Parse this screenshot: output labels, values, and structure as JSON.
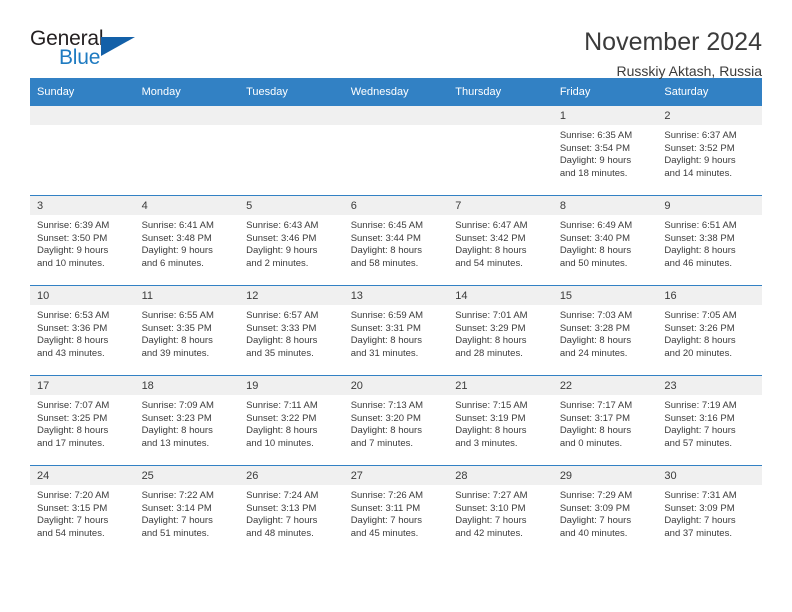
{
  "brand": {
    "general": "General",
    "blue": "Blue",
    "triangle_color": "#1360a8",
    "blue_color": "#1f7bc1"
  },
  "header": {
    "title": "November 2024",
    "subtitle": "Russkiy Aktash, Russia"
  },
  "theme": {
    "header_bg": "#3281c4",
    "daynum_band_bg": "#f0f0f0",
    "text": "#3b3b3b"
  },
  "weekday_headers": [
    "Sunday",
    "Monday",
    "Tuesday",
    "Wednesday",
    "Thursday",
    "Friday",
    "Saturday"
  ],
  "weeks": [
    [
      {
        "day": "",
        "sunrise": "",
        "sunset": "",
        "daylight_line1": "",
        "daylight_line2": ""
      },
      {
        "day": "",
        "sunrise": "",
        "sunset": "",
        "daylight_line1": "",
        "daylight_line2": ""
      },
      {
        "day": "",
        "sunrise": "",
        "sunset": "",
        "daylight_line1": "",
        "daylight_line2": ""
      },
      {
        "day": "",
        "sunrise": "",
        "sunset": "",
        "daylight_line1": "",
        "daylight_line2": ""
      },
      {
        "day": "",
        "sunrise": "",
        "sunset": "",
        "daylight_line1": "",
        "daylight_line2": ""
      },
      {
        "day": "1",
        "sunrise": "Sunrise: 6:35 AM",
        "sunset": "Sunset: 3:54 PM",
        "daylight_line1": "Daylight: 9 hours",
        "daylight_line2": "and 18 minutes."
      },
      {
        "day": "2",
        "sunrise": "Sunrise: 6:37 AM",
        "sunset": "Sunset: 3:52 PM",
        "daylight_line1": "Daylight: 9 hours",
        "daylight_line2": "and 14 minutes."
      }
    ],
    [
      {
        "day": "3",
        "sunrise": "Sunrise: 6:39 AM",
        "sunset": "Sunset: 3:50 PM",
        "daylight_line1": "Daylight: 9 hours",
        "daylight_line2": "and 10 minutes."
      },
      {
        "day": "4",
        "sunrise": "Sunrise: 6:41 AM",
        "sunset": "Sunset: 3:48 PM",
        "daylight_line1": "Daylight: 9 hours",
        "daylight_line2": "and 6 minutes."
      },
      {
        "day": "5",
        "sunrise": "Sunrise: 6:43 AM",
        "sunset": "Sunset: 3:46 PM",
        "daylight_line1": "Daylight: 9 hours",
        "daylight_line2": "and 2 minutes."
      },
      {
        "day": "6",
        "sunrise": "Sunrise: 6:45 AM",
        "sunset": "Sunset: 3:44 PM",
        "daylight_line1": "Daylight: 8 hours",
        "daylight_line2": "and 58 minutes."
      },
      {
        "day": "7",
        "sunrise": "Sunrise: 6:47 AM",
        "sunset": "Sunset: 3:42 PM",
        "daylight_line1": "Daylight: 8 hours",
        "daylight_line2": "and 54 minutes."
      },
      {
        "day": "8",
        "sunrise": "Sunrise: 6:49 AM",
        "sunset": "Sunset: 3:40 PM",
        "daylight_line1": "Daylight: 8 hours",
        "daylight_line2": "and 50 minutes."
      },
      {
        "day": "9",
        "sunrise": "Sunrise: 6:51 AM",
        "sunset": "Sunset: 3:38 PM",
        "daylight_line1": "Daylight: 8 hours",
        "daylight_line2": "and 46 minutes."
      }
    ],
    [
      {
        "day": "10",
        "sunrise": "Sunrise: 6:53 AM",
        "sunset": "Sunset: 3:36 PM",
        "daylight_line1": "Daylight: 8 hours",
        "daylight_line2": "and 43 minutes."
      },
      {
        "day": "11",
        "sunrise": "Sunrise: 6:55 AM",
        "sunset": "Sunset: 3:35 PM",
        "daylight_line1": "Daylight: 8 hours",
        "daylight_line2": "and 39 minutes."
      },
      {
        "day": "12",
        "sunrise": "Sunrise: 6:57 AM",
        "sunset": "Sunset: 3:33 PM",
        "daylight_line1": "Daylight: 8 hours",
        "daylight_line2": "and 35 minutes."
      },
      {
        "day": "13",
        "sunrise": "Sunrise: 6:59 AM",
        "sunset": "Sunset: 3:31 PM",
        "daylight_line1": "Daylight: 8 hours",
        "daylight_line2": "and 31 minutes."
      },
      {
        "day": "14",
        "sunrise": "Sunrise: 7:01 AM",
        "sunset": "Sunset: 3:29 PM",
        "daylight_line1": "Daylight: 8 hours",
        "daylight_line2": "and 28 minutes."
      },
      {
        "day": "15",
        "sunrise": "Sunrise: 7:03 AM",
        "sunset": "Sunset: 3:28 PM",
        "daylight_line1": "Daylight: 8 hours",
        "daylight_line2": "and 24 minutes."
      },
      {
        "day": "16",
        "sunrise": "Sunrise: 7:05 AM",
        "sunset": "Sunset: 3:26 PM",
        "daylight_line1": "Daylight: 8 hours",
        "daylight_line2": "and 20 minutes."
      }
    ],
    [
      {
        "day": "17",
        "sunrise": "Sunrise: 7:07 AM",
        "sunset": "Sunset: 3:25 PM",
        "daylight_line1": "Daylight: 8 hours",
        "daylight_line2": "and 17 minutes."
      },
      {
        "day": "18",
        "sunrise": "Sunrise: 7:09 AM",
        "sunset": "Sunset: 3:23 PM",
        "daylight_line1": "Daylight: 8 hours",
        "daylight_line2": "and 13 minutes."
      },
      {
        "day": "19",
        "sunrise": "Sunrise: 7:11 AM",
        "sunset": "Sunset: 3:22 PM",
        "daylight_line1": "Daylight: 8 hours",
        "daylight_line2": "and 10 minutes."
      },
      {
        "day": "20",
        "sunrise": "Sunrise: 7:13 AM",
        "sunset": "Sunset: 3:20 PM",
        "daylight_line1": "Daylight: 8 hours",
        "daylight_line2": "and 7 minutes."
      },
      {
        "day": "21",
        "sunrise": "Sunrise: 7:15 AM",
        "sunset": "Sunset: 3:19 PM",
        "daylight_line1": "Daylight: 8 hours",
        "daylight_line2": "and 3 minutes."
      },
      {
        "day": "22",
        "sunrise": "Sunrise: 7:17 AM",
        "sunset": "Sunset: 3:17 PM",
        "daylight_line1": "Daylight: 8 hours",
        "daylight_line2": "and 0 minutes."
      },
      {
        "day": "23",
        "sunrise": "Sunrise: 7:19 AM",
        "sunset": "Sunset: 3:16 PM",
        "daylight_line1": "Daylight: 7 hours",
        "daylight_line2": "and 57 minutes."
      }
    ],
    [
      {
        "day": "24",
        "sunrise": "Sunrise: 7:20 AM",
        "sunset": "Sunset: 3:15 PM",
        "daylight_line1": "Daylight: 7 hours",
        "daylight_line2": "and 54 minutes."
      },
      {
        "day": "25",
        "sunrise": "Sunrise: 7:22 AM",
        "sunset": "Sunset: 3:14 PM",
        "daylight_line1": "Daylight: 7 hours",
        "daylight_line2": "and 51 minutes."
      },
      {
        "day": "26",
        "sunrise": "Sunrise: 7:24 AM",
        "sunset": "Sunset: 3:13 PM",
        "daylight_line1": "Daylight: 7 hours",
        "daylight_line2": "and 48 minutes."
      },
      {
        "day": "27",
        "sunrise": "Sunrise: 7:26 AM",
        "sunset": "Sunset: 3:11 PM",
        "daylight_line1": "Daylight: 7 hours",
        "daylight_line2": "and 45 minutes."
      },
      {
        "day": "28",
        "sunrise": "Sunrise: 7:27 AM",
        "sunset": "Sunset: 3:10 PM",
        "daylight_line1": "Daylight: 7 hours",
        "daylight_line2": "and 42 minutes."
      },
      {
        "day": "29",
        "sunrise": "Sunrise: 7:29 AM",
        "sunset": "Sunset: 3:09 PM",
        "daylight_line1": "Daylight: 7 hours",
        "daylight_line2": "and 40 minutes."
      },
      {
        "day": "30",
        "sunrise": "Sunrise: 7:31 AM",
        "sunset": "Sunset: 3:09 PM",
        "daylight_line1": "Daylight: 7 hours",
        "daylight_line2": "and 37 minutes."
      }
    ]
  ]
}
